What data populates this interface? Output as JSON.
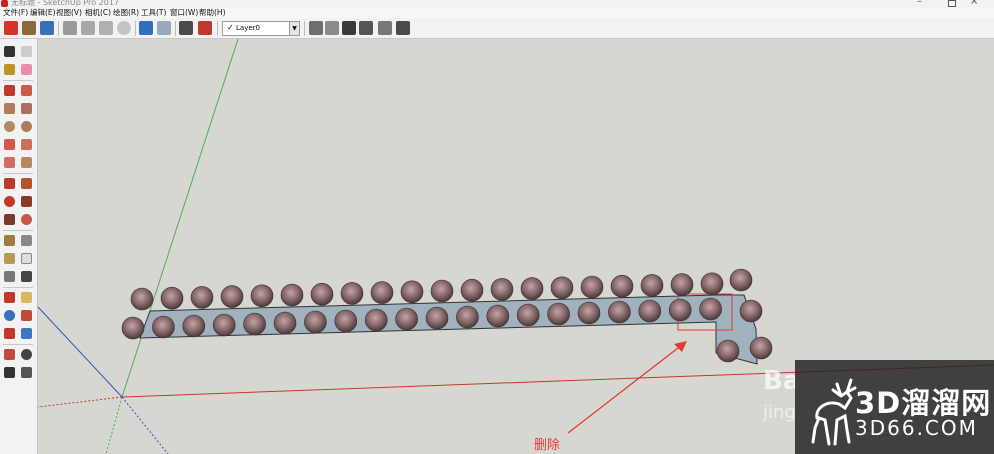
{
  "window": {
    "title": "无标题 - SketchUp Pro 2017"
  },
  "menu": {
    "items": [
      "文件(F)",
      "编辑(E)",
      "视图(V)",
      "相机(C)",
      "绘图(R)",
      "工具(T)",
      "窗口(W)",
      "帮助(H)"
    ]
  },
  "toolbar": {
    "layer_check": "✓",
    "layer_name": "Layer0",
    "layer_arrow": "▼"
  },
  "annotation": {
    "label": "删除"
  },
  "watermark": {
    "brand_cn": "3D溜溜网",
    "domain": "3D66.COM",
    "baidu": "Ba",
    "jing": "jing"
  },
  "colors": {
    "red_axis": "#c0392b",
    "green_axis": "#4caf50",
    "blue_axis": "#3a4fc1",
    "path_fill": "#9fb2bd",
    "annotation": "#e53935"
  }
}
